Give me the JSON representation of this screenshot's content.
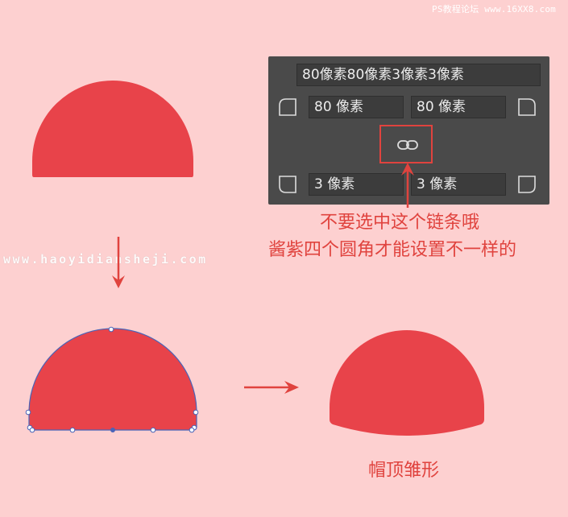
{
  "watermarks": {
    "top_right": "PS教程论坛 www.16XX8.com",
    "middle": "www.haoyidianshеji.com"
  },
  "panel": {
    "combined_value": "80像素80像素3像素3像素",
    "top_left_radius": "80 像素",
    "top_right_radius": "80 像素",
    "bottom_left_radius": "3 像素",
    "bottom_right_radius": "3 像素",
    "link_icon": "chain-link-icon"
  },
  "annotation": {
    "line1": "不要选中这个链条哦",
    "line2": "酱紫四个圆角才能设置不一样的"
  },
  "caption": "帽顶雏形",
  "colors": {
    "background": "#fdd0d0",
    "shape": "#e8434a",
    "accent": "#e0433e",
    "panel": "#4a4a4a"
  }
}
